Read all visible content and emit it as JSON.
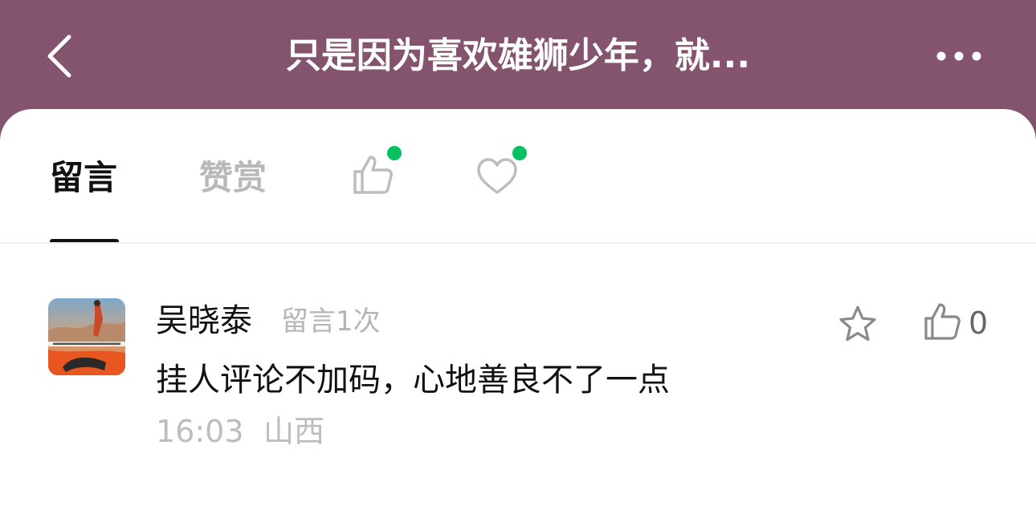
{
  "header": {
    "title": "只是因为喜欢雄狮少年，就...",
    "back_icon": "back-chevron-icon",
    "more_icon": "more-dots-icon",
    "background_color": "#84546f"
  },
  "tabs": [
    {
      "label": "留言",
      "active": true
    },
    {
      "label": "赞赏",
      "active": false
    },
    {
      "icon": "thumbs-up-icon",
      "has_badge": true
    },
    {
      "icon": "heart-icon",
      "has_badge": true
    }
  ],
  "badge_color": "#07c160",
  "comment": {
    "user_name": "吴晓泰",
    "comment_count_label": "留言1次",
    "text": "挂人评论不加码，心地善良不了一点",
    "time": "16:03",
    "location": "山西",
    "like_count": "0",
    "star_icon": "star-icon",
    "like_icon": "thumbs-up-icon"
  }
}
